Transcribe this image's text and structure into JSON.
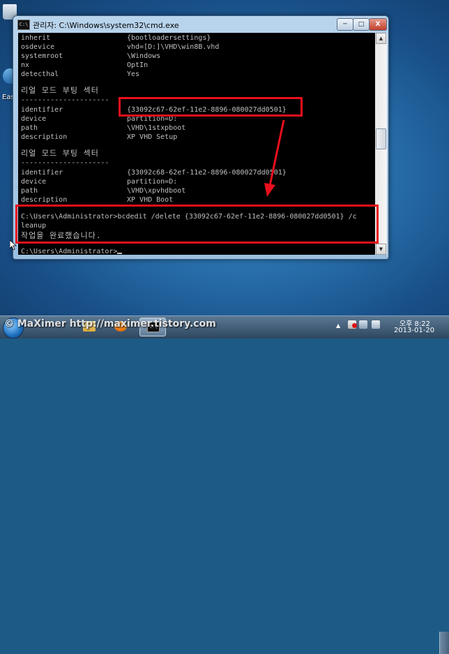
{
  "desktop": {
    "ease_label": "Eas"
  },
  "window": {
    "icon_text": "C:\\",
    "title": "관리자: C:\\Windows\\system32\\cmd.exe",
    "min_label": "─",
    "max_label": "□",
    "close_label": "X"
  },
  "console": {
    "lines": [
      {
        "key": "inherit",
        "value": "{bootloadersettings}"
      },
      {
        "key": "osdevice",
        "value": "vhd=[D:]\\VHD\\win8B.vhd"
      },
      {
        "key": "systemroot",
        "value": "\\Windows"
      },
      {
        "key": "nx",
        "value": "OptIn"
      },
      {
        "key": "detecthal",
        "value": "Yes"
      },
      {
        "key": "리얼 모드 부팅 섹터",
        "value": ""
      },
      {
        "key": "---------------------",
        "value": ""
      },
      {
        "key": "identifier",
        "value": "{33092c67-62ef-11e2-8896-080027dd0501}"
      },
      {
        "key": "device",
        "value": "partition=D:"
      },
      {
        "key": "path",
        "value": "\\VHD\\1stxpboot"
      },
      {
        "key": "description",
        "value": "XP VHD Setup"
      },
      {
        "key": "리얼 모드 부팅 섹터",
        "value": ""
      },
      {
        "key": "---------------------",
        "value": ""
      },
      {
        "key": "identifier",
        "value": "{33092c68-62ef-11e2-8896-080027dd0501}"
      },
      {
        "key": "device",
        "value": "partition=D:"
      },
      {
        "key": "path",
        "value": "\\VHD\\xpvhdboot"
      },
      {
        "key": "description",
        "value": "XP VHD Boot"
      },
      {
        "key": "C:\\Users\\Administrator>bcdedit /delete {33092c67-62ef-11e2-8896-080027dd0501} /c",
        "value": ""
      },
      {
        "key": "leanup",
        "value": ""
      },
      {
        "key": "작업을 완료했습니다.",
        "value": ""
      },
      {
        "key": "C:\\Users\\Administrator>",
        "value": ""
      }
    ]
  },
  "scrollbar": {
    "up": "▲",
    "down": "▼"
  },
  "watermark": "© MaXimer http://maximer.tistory.com",
  "taskbar": {
    "cmd_icon_text": "C:\\",
    "tray_arrow": "▲",
    "clock_time": "오후 8:22",
    "clock_date": "2013-01-20"
  },
  "colors": {
    "highlight_red": "#e8101c",
    "console_text": "#c0c0c0",
    "console_bg": "#000000"
  }
}
